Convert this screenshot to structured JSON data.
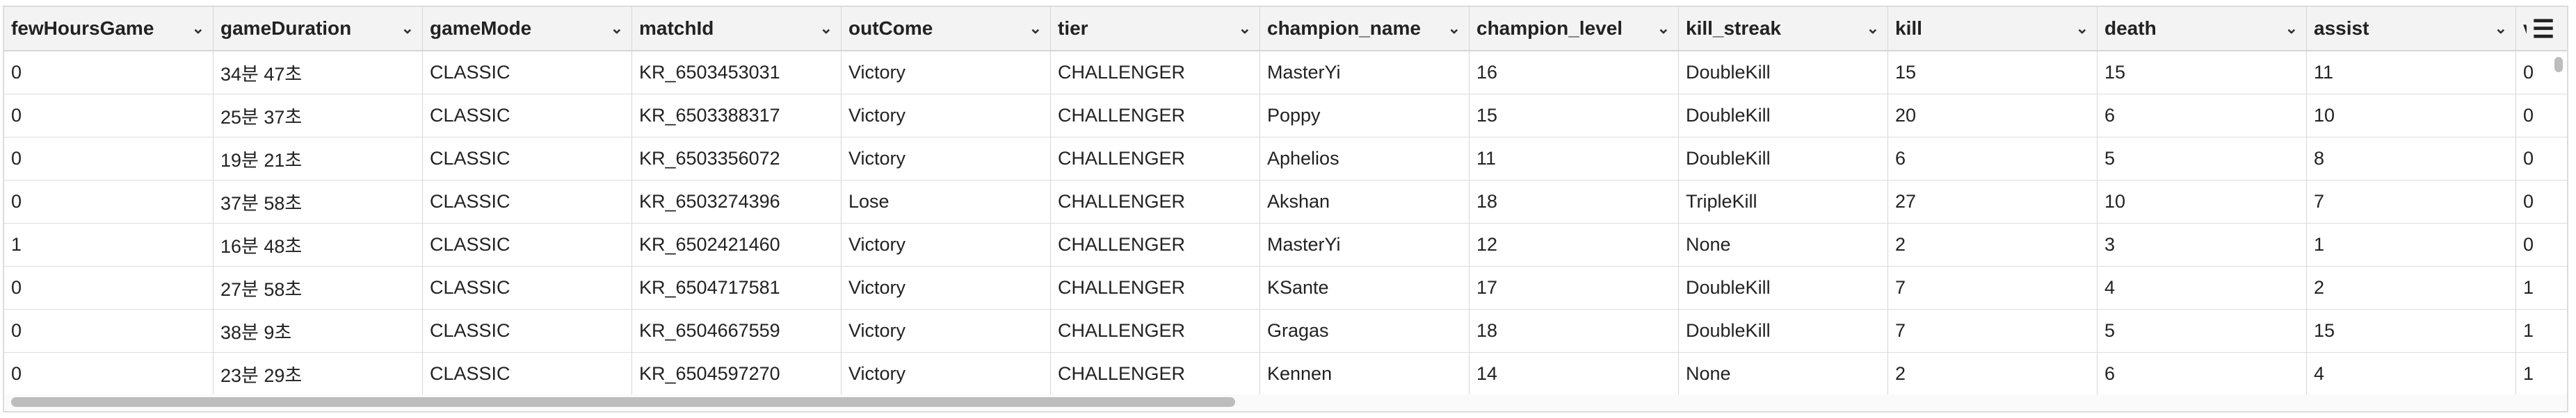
{
  "columns": [
    {
      "label": "fewHoursGame"
    },
    {
      "label": "gameDuration"
    },
    {
      "label": "gameMode"
    },
    {
      "label": "matchId"
    },
    {
      "label": "outCome"
    },
    {
      "label": "tier"
    },
    {
      "label": "champion_name"
    },
    {
      "label": "champion_level"
    },
    {
      "label": "kill_streak"
    },
    {
      "label": "kill"
    },
    {
      "label": "death"
    },
    {
      "label": "assist"
    },
    {
      "label": "vi"
    }
  ],
  "rows": [
    [
      "0",
      "34분 47초",
      "CLASSIC",
      "KR_6503453031",
      "Victory",
      "CHALLENGER",
      "MasterYi",
      "16",
      "DoubleKill",
      "15",
      "15",
      "11",
      "0"
    ],
    [
      "0",
      "25분 37초",
      "CLASSIC",
      "KR_6503388317",
      "Victory",
      "CHALLENGER",
      "Poppy",
      "15",
      "DoubleKill",
      "20",
      "6",
      "10",
      "0"
    ],
    [
      "0",
      "19분 21초",
      "CLASSIC",
      "KR_6503356072",
      "Victory",
      "CHALLENGER",
      "Aphelios",
      "11",
      "DoubleKill",
      "6",
      "5",
      "8",
      "0"
    ],
    [
      "0",
      "37분 58초",
      "CLASSIC",
      "KR_6503274396",
      "Lose",
      "CHALLENGER",
      "Akshan",
      "18",
      "TripleKill",
      "27",
      "10",
      "7",
      "0"
    ],
    [
      "1",
      "16분 48초",
      "CLASSIC",
      "KR_6502421460",
      "Victory",
      "CHALLENGER",
      "MasterYi",
      "12",
      "None",
      "2",
      "3",
      "1",
      "0"
    ],
    [
      "0",
      "27분 58초",
      "CLASSIC",
      "KR_6504717581",
      "Victory",
      "CHALLENGER",
      "KSante",
      "17",
      "DoubleKill",
      "7",
      "4",
      "2",
      "1"
    ],
    [
      "0",
      "38분 9초",
      "CLASSIC",
      "KR_6504667559",
      "Victory",
      "CHALLENGER",
      "Gragas",
      "18",
      "DoubleKill",
      "7",
      "5",
      "15",
      "1"
    ],
    [
      "0",
      "23분 29초",
      "CLASSIC",
      "KR_6504597270",
      "Victory",
      "CHALLENGER",
      "Kennen",
      "14",
      "None",
      "2",
      "6",
      "4",
      "1"
    ]
  ],
  "icons": {
    "sort": "chevron-down-icon",
    "menu": "column-menu-icon"
  },
  "sort_glyph": "⌄",
  "menu_glyph": "☰"
}
